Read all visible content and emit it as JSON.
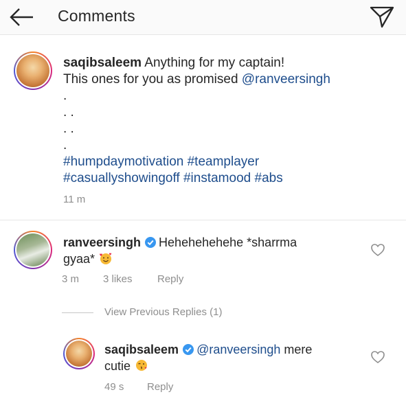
{
  "header": {
    "title": "Comments",
    "back_icon": "arrow-left-icon",
    "send_icon": "direct-send-icon"
  },
  "caption": {
    "username": "saqibsaleem",
    "line1": " Anything for my captain!",
    "line2_text": "This ones for you as promised ",
    "line2_mention": "@ranveersingh",
    "dots": [
      ".",
      ". .",
      ". .",
      "."
    ],
    "hashtags_line1": [
      "#humpdaymotivation",
      "#teamplayer"
    ],
    "hashtags_line2": [
      "#casuallyshowingoff",
      "#instamood",
      "#abs"
    ],
    "time": "11 m"
  },
  "comment": {
    "username": "ranveersingh",
    "text_line1": "Hehehehehehe *sharrma",
    "text_line2": "gyaa*",
    "emoji": "smiling-face-with-hearts",
    "time": "3 m",
    "likes": "3 likes",
    "reply_label": "Reply"
  },
  "view_previous_replies": "View Previous Replies (1)",
  "reply": {
    "username": "saqibsaleem",
    "mention": "@ranveersingh",
    "text_line1": " mere",
    "text_line2": "cutie",
    "emoji": "face-blowing-kiss",
    "time": "49 s",
    "reply_label": "Reply"
  },
  "colors": {
    "link_blue": "#1e4d8c",
    "verified_blue": "#3897f0",
    "meta_gray": "#8e8e8e"
  }
}
